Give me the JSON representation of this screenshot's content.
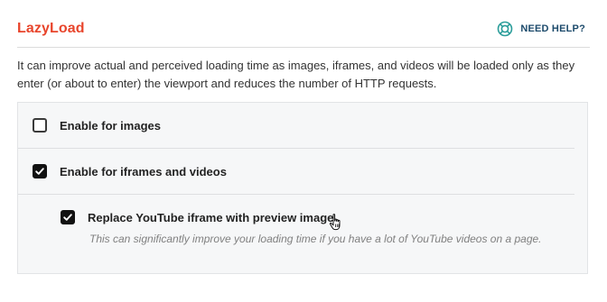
{
  "header": {
    "title": "LazyLoad",
    "help_label": "NEED HELP?"
  },
  "description": "It can improve actual and perceived loading time as images, iframes, and videos will be loaded only as they enter (or about to enter) the viewport and reduces the number of HTTP requests.",
  "options": {
    "images": {
      "label": "Enable for images",
      "checked": false
    },
    "iframes": {
      "label": "Enable for iframes and videos",
      "checked": true
    },
    "youtube": {
      "label": "Replace YouTube iframe with preview image",
      "checked": true,
      "hint": "This can significantly improve your loading time if you have a lot of YouTube videos on a page."
    }
  },
  "colors": {
    "title": "#e8452c",
    "help_icon": "#2a9d9a",
    "help_text": "#1c4a6b",
    "checkbox_checked": "#111111"
  },
  "icons": [
    "lifebuoy-icon",
    "checkmark-icon",
    "hand-pointer-cursor"
  ]
}
